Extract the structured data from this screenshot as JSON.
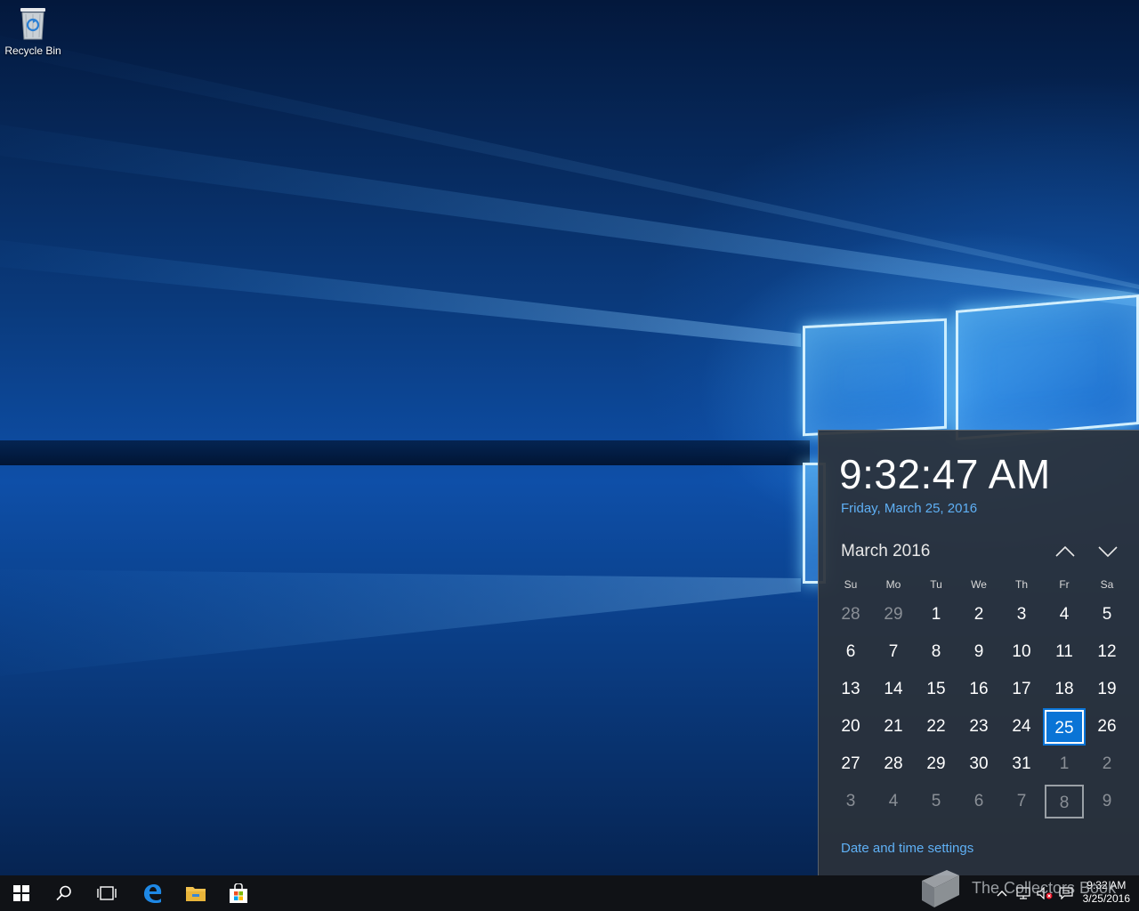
{
  "desktop": {
    "recycle_bin_label": "Recycle Bin"
  },
  "flyout": {
    "time": "9:32:47 AM",
    "date": "Friday, March 25, 2016",
    "month_label": "March 2016",
    "days_of_week": [
      "Su",
      "Mo",
      "Tu",
      "We",
      "Th",
      "Fr",
      "Sa"
    ],
    "weeks": [
      [
        "28",
        "29",
        "1",
        "2",
        "3",
        "4",
        "5"
      ],
      [
        "6",
        "7",
        "8",
        "9",
        "10",
        "11",
        "12"
      ],
      [
        "13",
        "14",
        "15",
        "16",
        "17",
        "18",
        "19"
      ],
      [
        "20",
        "21",
        "22",
        "23",
        "24",
        "25",
        "26"
      ],
      [
        "27",
        "28",
        "29",
        "30",
        "31",
        "1",
        "2"
      ],
      [
        "3",
        "4",
        "5",
        "6",
        "7",
        "8",
        "9"
      ]
    ],
    "settings_link": "Date and time settings"
  },
  "taskbar": {
    "clock_time": "9:32 AM",
    "clock_date": "3/25/2016"
  },
  "watermark": "The Collectors Book",
  "colors": {
    "accent": "#0a74d6",
    "link": "#5fb0f5",
    "flyout_bg": "#2b313a",
    "taskbar_bg": "#101216"
  },
  "icons": [
    "start-icon",
    "search-icon",
    "task-view-icon",
    "edge-icon",
    "file-explorer-icon",
    "store-icon",
    "tray-chevron-icon",
    "network-icon",
    "volume-muted-icon",
    "action-center-icon",
    "recycle-bin-icon"
  ]
}
